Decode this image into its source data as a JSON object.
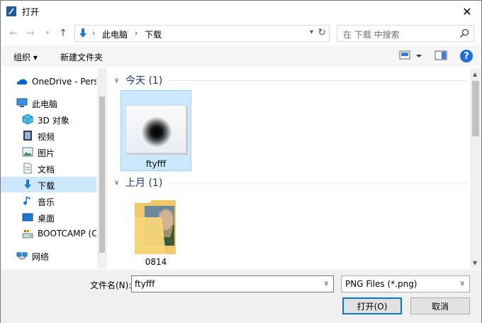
{
  "window": {
    "title": "打开"
  },
  "address": {
    "crumbs": [
      "此电脑",
      "下载"
    ]
  },
  "search": {
    "placeholder": "在 下载 中搜索"
  },
  "toolbar": {
    "organize": "组织 ▾",
    "new_folder": "新建文件夹"
  },
  "sidebar": {
    "items": [
      {
        "label": "OneDrive - Perso",
        "icon": "onedrive-icon"
      },
      {
        "label": "此电脑",
        "icon": "computer-icon"
      },
      {
        "label": "3D 对象",
        "icon": "3d-objects-icon"
      },
      {
        "label": "视频",
        "icon": "video-icon"
      },
      {
        "label": "图片",
        "icon": "pictures-icon"
      },
      {
        "label": "文档",
        "icon": "documents-icon"
      },
      {
        "label": "下载",
        "icon": "download-icon",
        "selected": true
      },
      {
        "label": "音乐",
        "icon": "music-icon"
      },
      {
        "label": "桌面",
        "icon": "desktop-icon"
      },
      {
        "label": "BOOTCAMP (C",
        "icon": "drive-icon"
      },
      {
        "label": "网络",
        "icon": "network-icon"
      }
    ]
  },
  "groups": [
    {
      "title": "今天 (1)",
      "files": [
        {
          "name": "ftyfff",
          "selected": true
        }
      ]
    },
    {
      "title": "上月 (1)",
      "files": [
        {
          "name": "0814",
          "selected": false
        }
      ]
    }
  ],
  "bottom": {
    "filename_label": "文件名(N):",
    "filename_value": "ftyfff",
    "filetype_value": "PNG Files (*.png)",
    "open_label": "打开(O)",
    "cancel_label": "取消"
  },
  "colors": {
    "selection": "#cce8ff",
    "accent": "#0078d7",
    "group_title": "#1e3287"
  }
}
